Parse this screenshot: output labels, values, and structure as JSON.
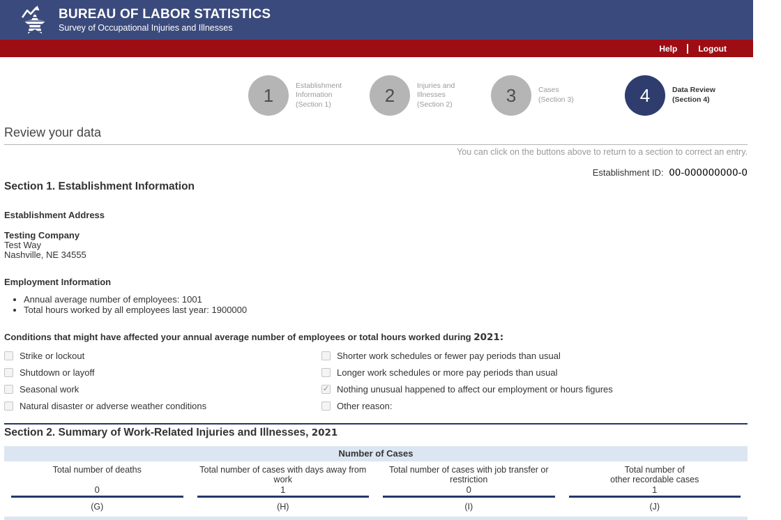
{
  "header": {
    "title": "BUREAU OF LABOR STATISTICS",
    "subtitle": "Survey of Occupational Injuries and Illnesses",
    "help": "Help",
    "logout": "Logout"
  },
  "colors": {
    "navy_bar": "#3b4a7c",
    "red_bar": "#9e0d14",
    "active_step": "#2e3d6e",
    "table_header_bg": "#dce6f2",
    "rule_navy": "#1f3864"
  },
  "steps": [
    {
      "number": "1",
      "label": "Establishment\nInformation\n(Section 1)",
      "active": false
    },
    {
      "number": "2",
      "label": "Injuries and\nIllnesses\n(Section 2)",
      "active": false
    },
    {
      "number": "3",
      "label": "Cases\n(Section 3)",
      "active": false
    },
    {
      "number": "4",
      "label": "Data Review\n(Section 4)",
      "active": true
    }
  ],
  "page": {
    "title": "Review your data",
    "note": "You can click on the buttons above to return to a section to correct an entry.",
    "establishment_id_label": "Establishment ID:",
    "establishment_id": "00-000000000-0"
  },
  "section1": {
    "heading": "Section 1. Establishment Information",
    "address_heading": "Establishment Address",
    "company": "Testing Company",
    "street": "Test Way",
    "city": "Nashville, NE 34555",
    "employment_heading": "Employment Information",
    "bullets": [
      "Annual average number of employees: 1001",
      "Total hours worked by all employees last year: 1900000"
    ],
    "conditions_heading": "Conditions that might have affected your annual average number of employees or total hours worked during",
    "conditions_year": "2021:",
    "conditions_left": [
      {
        "label": "Strike or lockout",
        "checked": false
      },
      {
        "label": "Shutdown or layoff",
        "checked": false
      },
      {
        "label": "Seasonal work",
        "checked": false
      },
      {
        "label": "Natural disaster or adverse weather conditions",
        "checked": false
      }
    ],
    "conditions_right": [
      {
        "label": "Shorter work schedules or fewer pay periods than usual",
        "checked": false
      },
      {
        "label": "Longer work schedules or more pay periods than usual",
        "checked": false
      },
      {
        "label": "Nothing unusual happened to affect our employment or hours figures",
        "checked": true
      },
      {
        "label": "Other reason:",
        "checked": false
      }
    ]
  },
  "section2": {
    "heading": "Section 2. Summary of Work-Related Injuries and Illnesses,",
    "year": "2021",
    "table": {
      "title": "Number of Cases",
      "columns": [
        {
          "label": "Total number of deaths",
          "value": "0",
          "letter": "(G)"
        },
        {
          "label": "Total number of cases with days away from work",
          "value": "1",
          "letter": "(H)"
        },
        {
          "label": "Total number of cases with job transfer or restriction",
          "value": "0",
          "letter": "(I)"
        },
        {
          "label": "Total number of\nother recordable cases",
          "value": "1",
          "letter": "(J)"
        }
      ]
    }
  }
}
